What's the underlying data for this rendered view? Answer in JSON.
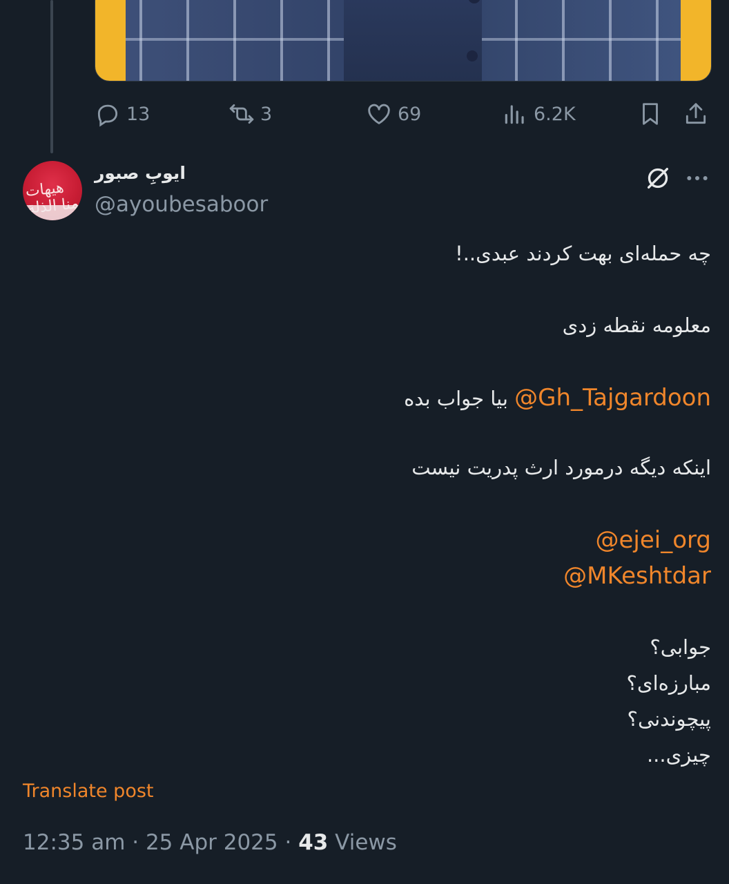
{
  "previous_post": {
    "actions": {
      "replies": "13",
      "reposts": "3",
      "likes": "69",
      "views": "6.2K"
    }
  },
  "post": {
    "author": {
      "display_name": "ایوبِ صبور",
      "handle": "@ayoubesaboor",
      "avatar_text": "هیهات منا الذلة"
    },
    "lines": [
      "چه حمله‌ای بهت کردند عبدی..!",
      "معلومه نقطه زدی",
      "بیا جواب بده",
      "اینکه دیگه درمورد ارث پدریت نیست",
      "جوابی؟",
      "مبارزه‌ای؟",
      "پیچوندنی؟",
      "چیزی..."
    ],
    "mentions": {
      "first": "@Gh_Tajgardoon",
      "second": "@ejei_org",
      "third": "@MKeshtdar"
    },
    "translate_label": "Translate post",
    "timestamp": "12:35 am · 25 Apr 2025 · ",
    "views_count": "43",
    "views_label": " Views"
  }
}
